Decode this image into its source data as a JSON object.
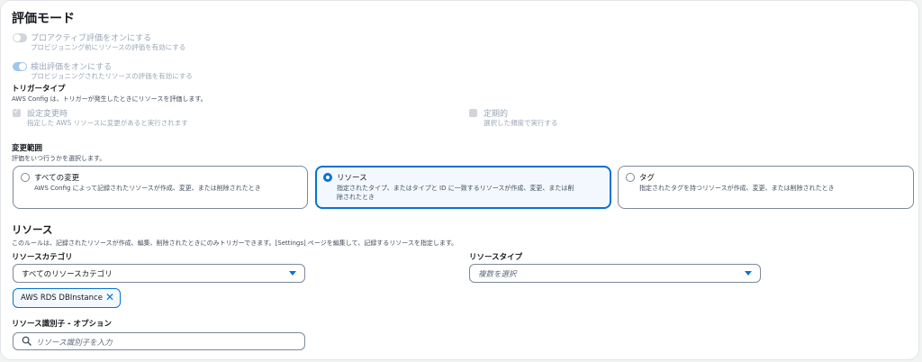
{
  "title": "評価モード",
  "proactive": {
    "label": "プロアクティブ評価をオンにする",
    "desc": "プロビジョニング前にリソースの評価を有効にする",
    "enabled": false
  },
  "detective": {
    "label": "検出評価をオンにする",
    "desc": "プロビジョニングされたリソースの評価を有効にする",
    "enabled": true
  },
  "trigger": {
    "title": "トリガータイプ",
    "desc": "AWS Config は、トリガーが発生したときにリソースを評価します。",
    "config_change": {
      "label": "設定変更時",
      "desc": "指定した AWS リソースに変更があると実行されます",
      "checked": true
    },
    "periodic": {
      "label": "定期的",
      "desc": "選択した頻度で実行する",
      "checked": false
    }
  },
  "scope": {
    "title": "変更範囲",
    "desc": "評価をいつ行うかを選択します。",
    "options": [
      {
        "label": "すべての変更",
        "desc": "AWS Config によって記録されたリソースが作成、変更、または削除されたとき"
      },
      {
        "label": "リソース",
        "desc": "指定されたタイプ、またはタイプと ID に一致するリソースが作成、変更、または削\n除されたとき"
      },
      {
        "label": "タグ",
        "desc": "指定されたタグを持つリソースが作成、変更、または削除されたとき"
      }
    ],
    "selected": "リソース"
  },
  "resources": {
    "title": "リソース",
    "desc": "このルールは、記録されたリソースが作成、編集、削除されたときにのみトリガーできます。[Settings] ページを編集して、記録するリソースを指定します。",
    "category_label": "リソースカテゴリ",
    "category_value": "すべてのリソースカテゴリ",
    "type_label": "リソースタイプ",
    "type_placeholder": "複数を選択",
    "token": "AWS RDS DBInstance",
    "identifier_label": "リソース識別子 - オプション",
    "identifier_placeholder": "リソース識別子を入力"
  },
  "colors": {
    "accent": "#0972d3",
    "disabled": "#9ba7b6",
    "text": "#16191f"
  }
}
